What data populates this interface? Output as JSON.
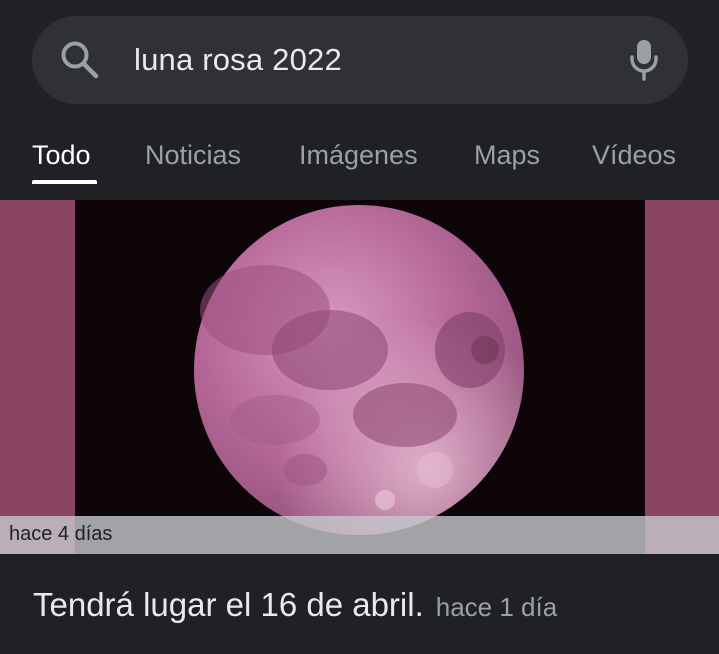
{
  "search": {
    "query": "luna rosa 2022",
    "left_icon": "search-icon",
    "right_icon": "mic-icon"
  },
  "tabs": [
    {
      "label": "Todo",
      "active": true
    },
    {
      "label": "Noticias",
      "active": false
    },
    {
      "label": "Imágenes",
      "active": false
    },
    {
      "label": "Maps",
      "active": false
    },
    {
      "label": "Vídeos",
      "active": false
    }
  ],
  "result_image": {
    "time_label": "hace 4 días"
  },
  "snippet": {
    "text": "Tendrá lugar el 16 de abril.",
    "time": "hace 1 día"
  },
  "colors": {
    "background": "#202124",
    "search_bar": "#303134",
    "side_bars": "#8a4562",
    "moon": "#c07aa4"
  }
}
